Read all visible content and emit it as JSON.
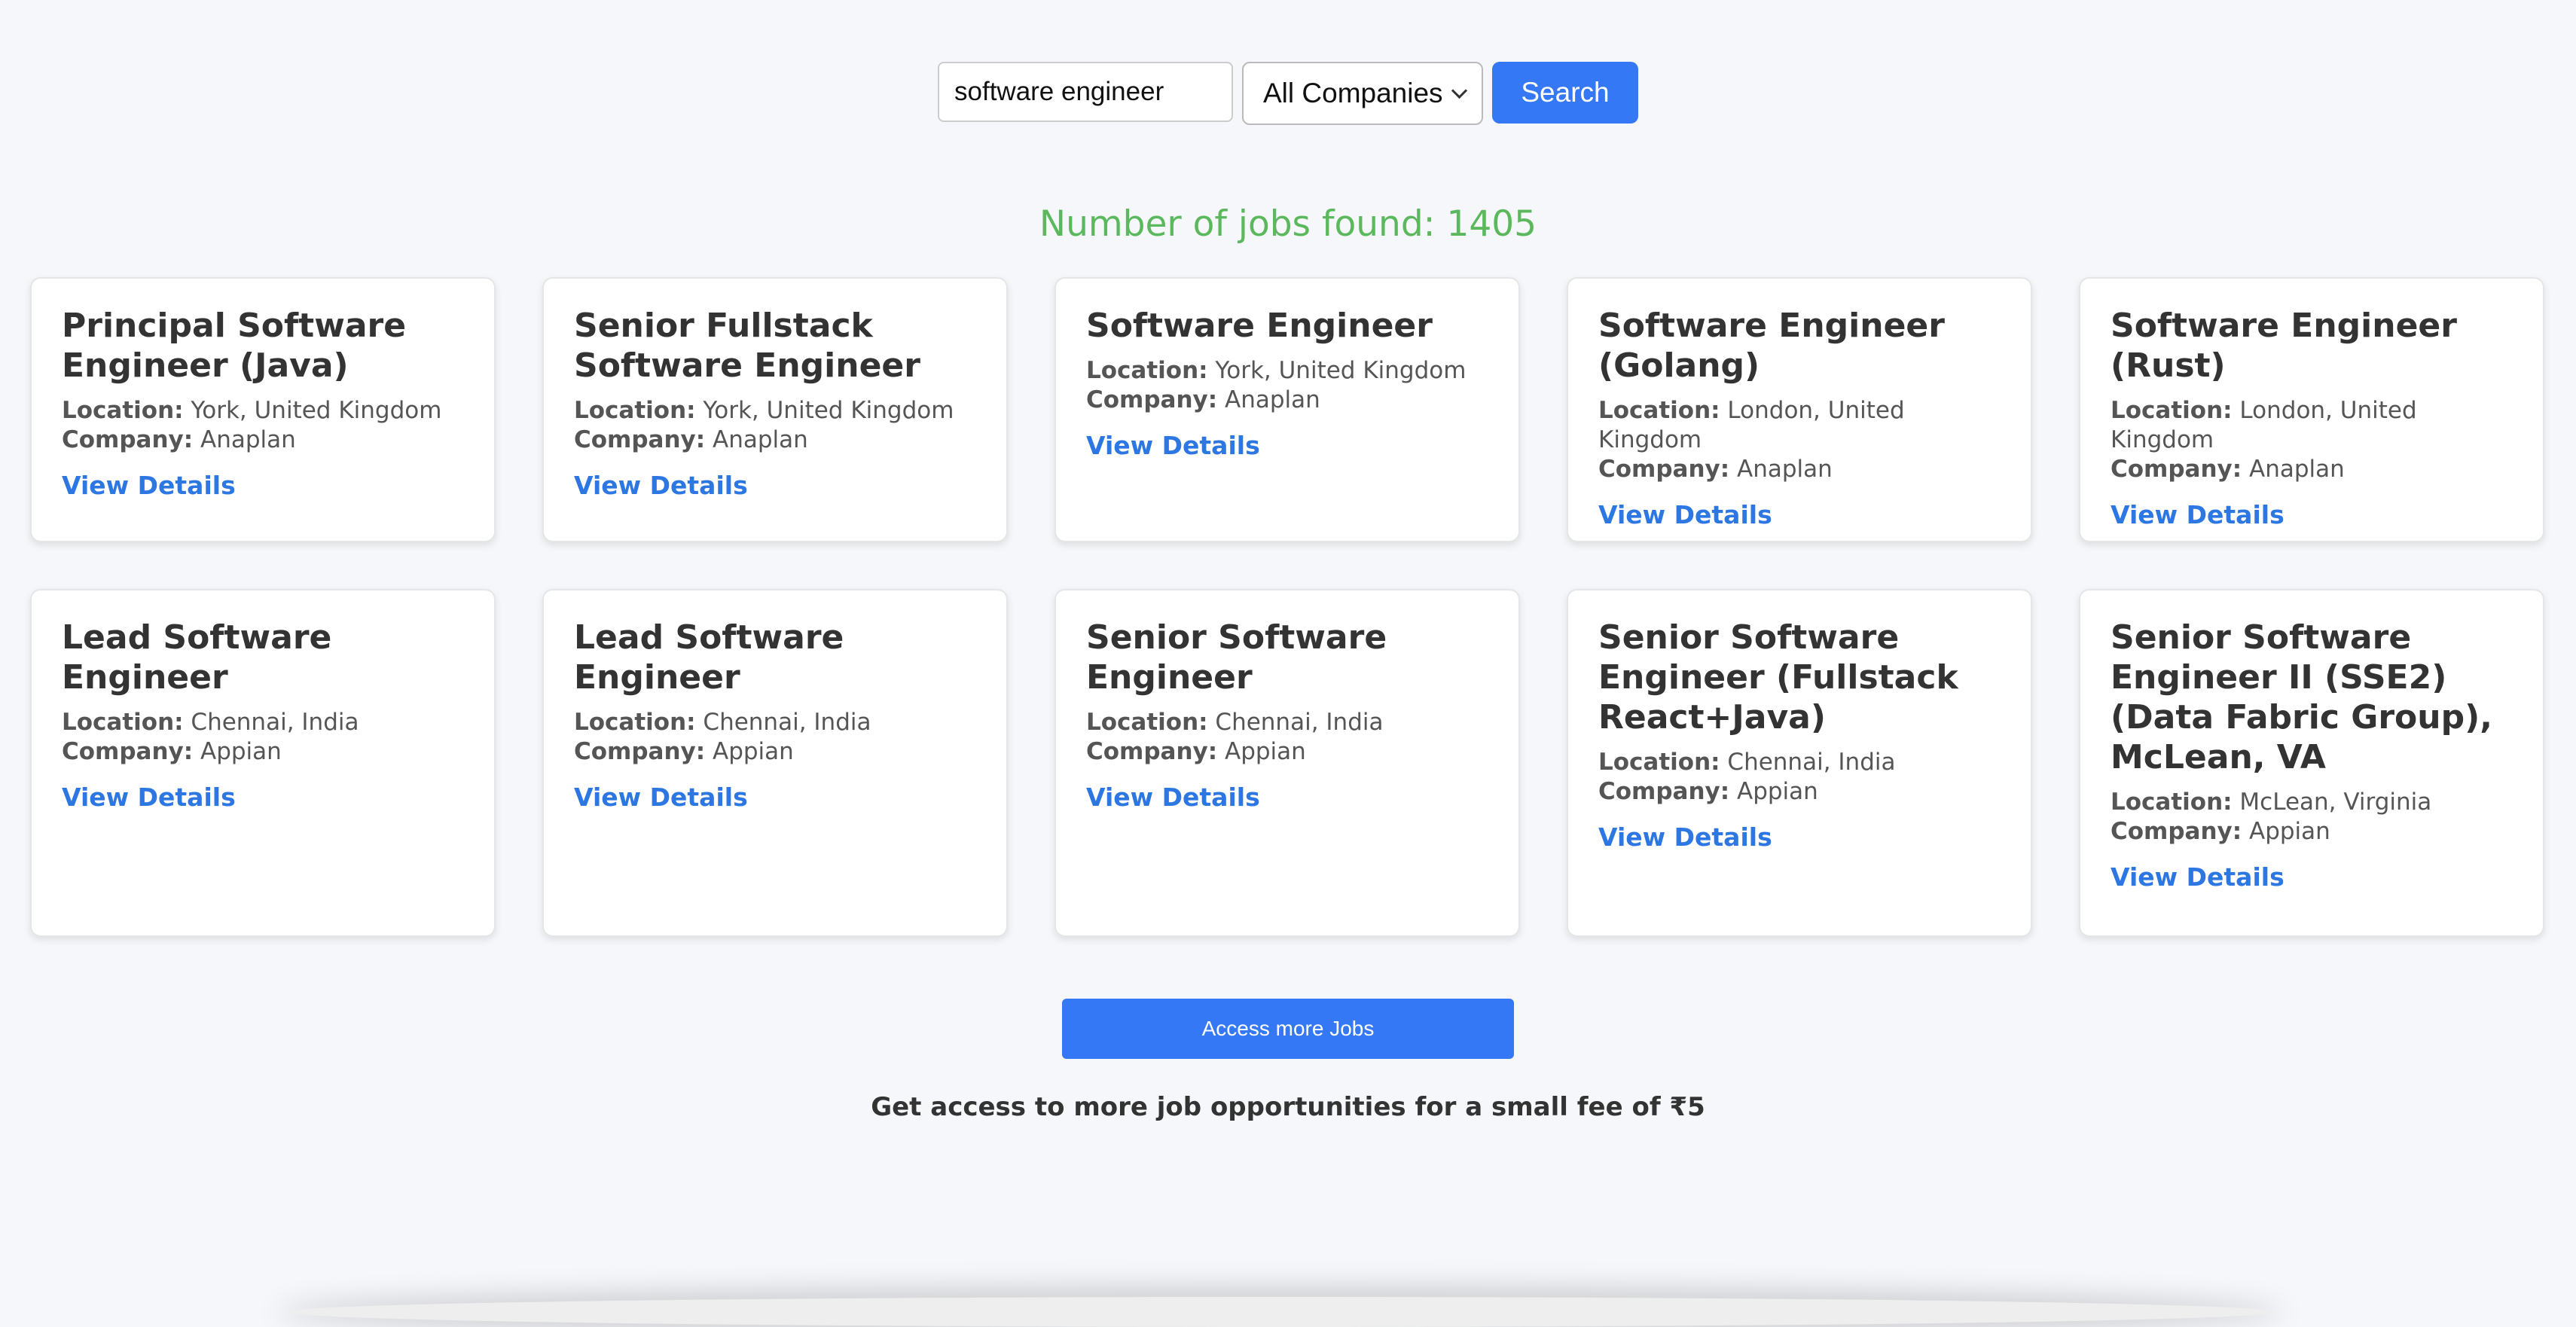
{
  "search": {
    "query": "software engineer",
    "company_selected": "All Companies",
    "button_label": "Search"
  },
  "results": {
    "count_text": "Number of jobs found: 1405"
  },
  "labels": {
    "location": "Location:",
    "company": "Company:",
    "view_details": "View Details"
  },
  "jobs": [
    {
      "title": "Principal Software Engineer (Java)",
      "location": "York, United Kingdom",
      "company": "Anaplan"
    },
    {
      "title": "Senior Fullstack Software Engineer",
      "location": "York, United Kingdom",
      "company": "Anaplan"
    },
    {
      "title": "Software Engineer",
      "location": "York, United Kingdom",
      "company": "Anaplan"
    },
    {
      "title": "Software Engineer (Golang)",
      "location": "London, United Kingdom",
      "company": "Anaplan"
    },
    {
      "title": "Software Engineer (Rust)",
      "location": "London, United Kingdom",
      "company": "Anaplan"
    },
    {
      "title": "Lead Software Engineer",
      "location": "Chennai, India",
      "company": "Appian"
    },
    {
      "title": "Lead Software Engineer",
      "location": "Chennai, India",
      "company": "Appian"
    },
    {
      "title": "Senior Software Engineer",
      "location": "Chennai, India",
      "company": "Appian"
    },
    {
      "title": "Senior Software Engineer (Fullstack React+Java)",
      "location": "Chennai, India",
      "company": "Appian"
    },
    {
      "title": "Senior Software Engineer II (SSE2) (Data Fabric Group), McLean, VA",
      "location": "McLean, Virginia",
      "company": "Appian"
    }
  ],
  "footer": {
    "access_button_label": "Access more Jobs",
    "fee_text": "Get access to more job opportunities for a small fee of ₹5"
  },
  "colors": {
    "background": "#f5f7fa",
    "primary_button": "#3478f6",
    "link": "#2d77e3",
    "count_text": "#5cb85c"
  }
}
